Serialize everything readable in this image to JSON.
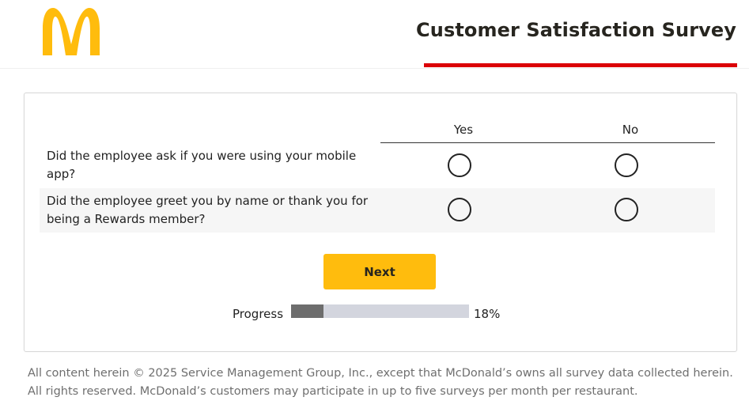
{
  "header": {
    "title": "Customer Satisfaction Survey",
    "accent_color": "#db0007",
    "logo_color": "#ffbc0d"
  },
  "question_table": {
    "columns": [
      "Yes",
      "No"
    ],
    "rows": [
      {
        "question": "Did the employee ask if you were using your mobile app?"
      },
      {
        "question": "Did the employee greet you by name or thank you for being a Rewards member?"
      }
    ]
  },
  "navigation": {
    "next_label": "Next"
  },
  "progress": {
    "label": "Progress",
    "percent": 18,
    "percent_text": "18%"
  },
  "footer": {
    "text": "All content herein © 2025 Service Management Group, Inc., except that McDonald’s owns all survey data collected herein. All rights reserved. McDonald’s customers may participate in up to five surveys per month per restaurant."
  }
}
